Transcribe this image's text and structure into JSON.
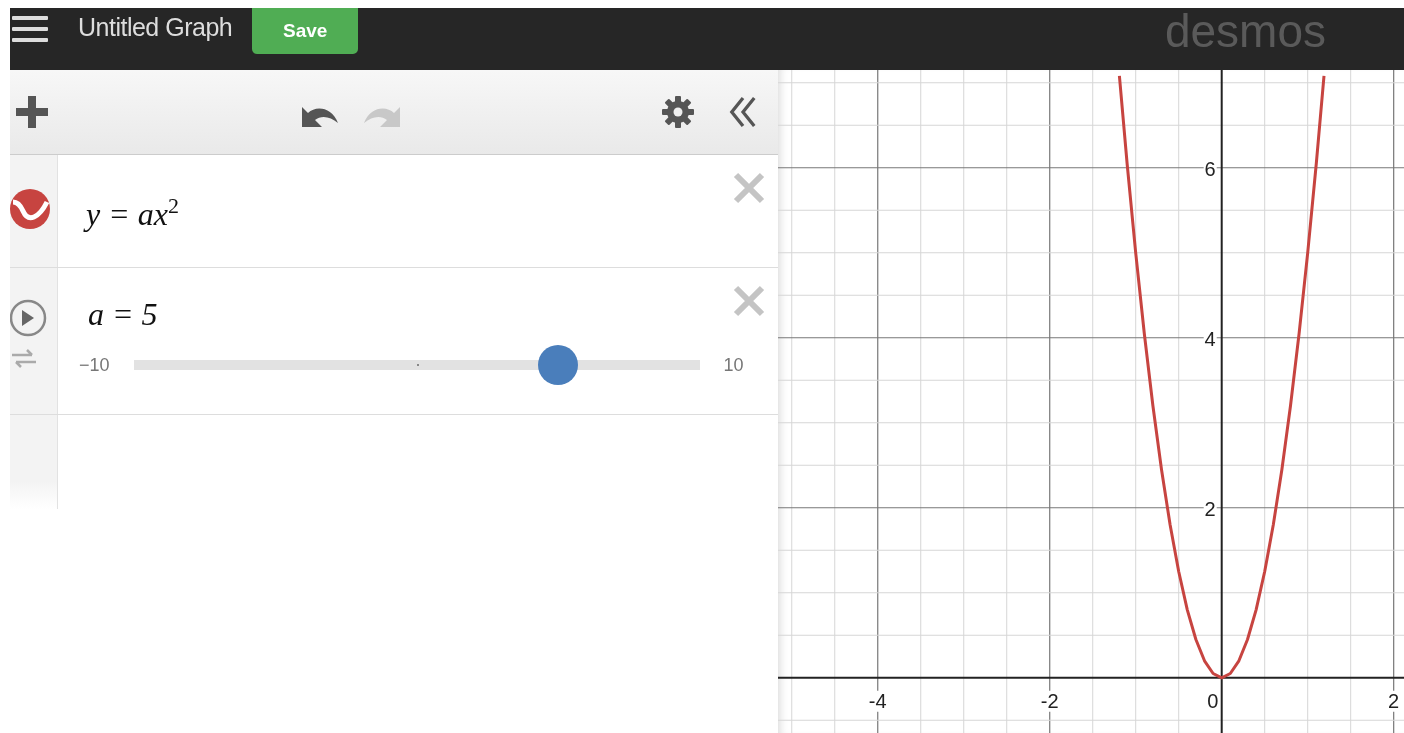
{
  "top_bar": {
    "title": "Untitled Graph",
    "save_button": "Save",
    "logo": "desmos"
  },
  "expressions": [
    {
      "kind": "expression",
      "latex": "y = ax$^{2}$",
      "color": "#c74440"
    },
    {
      "kind": "slider",
      "latex": "a = 5",
      "min": "−10",
      "max": "10",
      "level": 0.75
    }
  ],
  "graph": {
    "chart_data": {
      "type": "line",
      "x": [
        -1.19,
        -1.1,
        -1,
        -0.9,
        -0.8,
        -0.7,
        -0.6,
        -0.5,
        -0.4,
        -0.3,
        -0.2,
        -0.1,
        0,
        0.1,
        0.2,
        0.3,
        0.4,
        0.5,
        0.6,
        0.7,
        0.8,
        0.9,
        1,
        1.1,
        1.19
      ],
      "series": [
        {
          "color": "#c74440",
          "values": [
            7.0805,
            6.05,
            5,
            4.05,
            3.2,
            2.45,
            1.8,
            1.25,
            0.8,
            0.45,
            0.2,
            0.05,
            0,
            0.05,
            0.2,
            0.45,
            0.8,
            1.25,
            1.8,
            2.45,
            3.2,
            4.05,
            5,
            6.05,
            7.0805
          ]
        }
      ],
      "grid": true,
      "xlim": [
        -5.16,
        2.12
      ],
      "ylim": [
        -0.65,
        7.15
      ],
      "xticks": [
        -4,
        -2,
        0,
        2
      ],
      "yticks": [
        2,
        4,
        6
      ]
    }
  }
}
